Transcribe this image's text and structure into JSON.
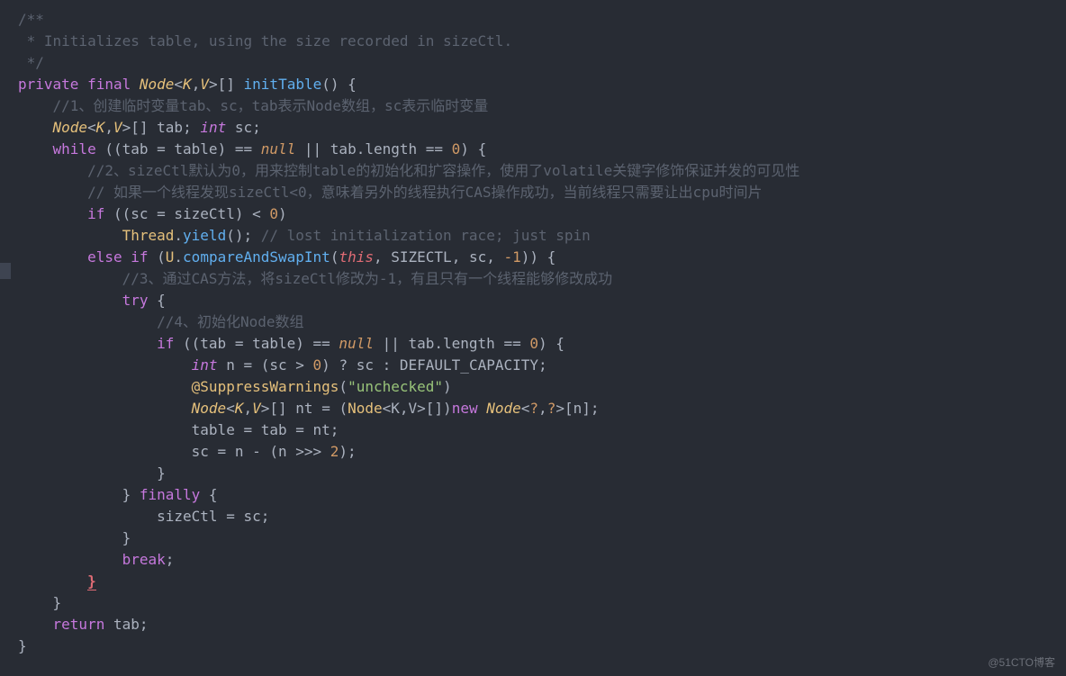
{
  "code": {
    "l1_comment_open": "/**",
    "l2_comment": " * Initializes table, using the size recorded in sizeCtl.",
    "l3_comment_close": " */",
    "l4": {
      "kw_private": "private",
      "kw_final": "final",
      "type_node": "Node",
      "generic_open": "<",
      "type_k": "K",
      "comma": ",",
      "type_v": "V",
      "generic_close": ">",
      "array": "[]",
      "method": "initTable",
      "parens": "()",
      "brace": " {"
    },
    "l5_comment": "    //1、创建临时变量tab、sc，tab表示Node数组，sc表示临时变量",
    "l6": {
      "indent": "    ",
      "type_node": "Node",
      "lt": "<",
      "k": "K",
      "c": ",",
      "v": "V",
      "gt": ">",
      "arr_tab": "[] tab; ",
      "int_kw": "int",
      "sc": " sc;"
    },
    "l7": {
      "indent": "    ",
      "while": "while",
      "cond_a": " ((tab = table) == ",
      "null": "null",
      "cond_b": " || tab.length == ",
      "zero": "0",
      "end": ") {"
    },
    "l8_comment": "        //2、sizeCtl默认为0，用来控制table的初始化和扩容操作，使用了volatile关键字修饰保证并发的可见性",
    "l9_comment": "        // 如果一个线程发现sizeCtl<0，意味着另外的线程执行CAS操作成功，当前线程只需要让出cpu时间片",
    "l10": {
      "indent": "        ",
      "if": "if",
      "cond": " ((sc = sizeCtl) < ",
      "zero": "0",
      "close": ")"
    },
    "l11": {
      "indent": "            ",
      "thread": "Thread",
      "dot": ".",
      "yield": "yield",
      "parens": "(); ",
      "comment": "// lost initialization race; just spin"
    },
    "l12": {
      "indent": "        ",
      "else": "else",
      "sp": " ",
      "if": "if",
      "open": " (",
      "u": "U",
      "dot": ".",
      "cas": "compareAndSwapInt",
      "args_a": "(",
      "this": "this",
      "comma1": ", ",
      "sizectl": "SIZECTL",
      "comma2": ", sc, ",
      "neg1": "-1",
      "close": ")) {"
    },
    "l13_comment": "            //3、通过CAS方法，将sizeCtl修改为-1，有且只有一个线程能够修改成功",
    "l14": {
      "indent": "            ",
      "try": "try",
      "brace": " {"
    },
    "l15_comment": "                //4、初始化Node数组",
    "l16": {
      "indent": "                ",
      "if": "if",
      "cond_a": " ((tab = table) == ",
      "null": "null",
      "cond_b": " || tab.length == ",
      "zero": "0",
      "close": ") {"
    },
    "l17": {
      "indent": "                    ",
      "int": "int",
      "rest_a": " n = (sc > ",
      "zero": "0",
      "rest_b": ") ? sc : ",
      "default_cap": "DEFAULT_CAPACITY",
      "semi": ";"
    },
    "l18": {
      "indent": "                    ",
      "at": "@",
      "anno": "SuppressWarnings",
      "open": "(",
      "str": "\"unchecked\"",
      "close": ")"
    },
    "l19": {
      "indent": "                    ",
      "node1": "Node",
      "g1": "<",
      "k1": "K",
      "c1": ",",
      "v1": "V",
      "g1c": ">",
      "arr1": "[] nt = (",
      "node2": "Node",
      "g2": "<K,V>[])",
      "new": "new",
      "sp": " ",
      "node3": "Node",
      "g3": "<",
      "q1": "?",
      "c3": ",",
      "q2": "?",
      "g3c": ">",
      "tail": "[n];"
    },
    "l20": "                    table = tab = nt;",
    "l21": {
      "indent": "                    sc = n - (n >>> ",
      "two": "2",
      "close": ");"
    },
    "l22": "                }",
    "l23": {
      "indent": "            } ",
      "finally": "finally",
      "brace": " {"
    },
    "l24": "                sizeCtl = sc;",
    "l25": "            }",
    "l26": {
      "indent": "            ",
      "break": "break",
      "semi": ";"
    },
    "l27": "        }",
    "l28": "    }",
    "l29": {
      "indent": "    ",
      "return": "return",
      "tab": " tab;"
    },
    "l30": "}"
  },
  "watermark": "@51CTO博客"
}
